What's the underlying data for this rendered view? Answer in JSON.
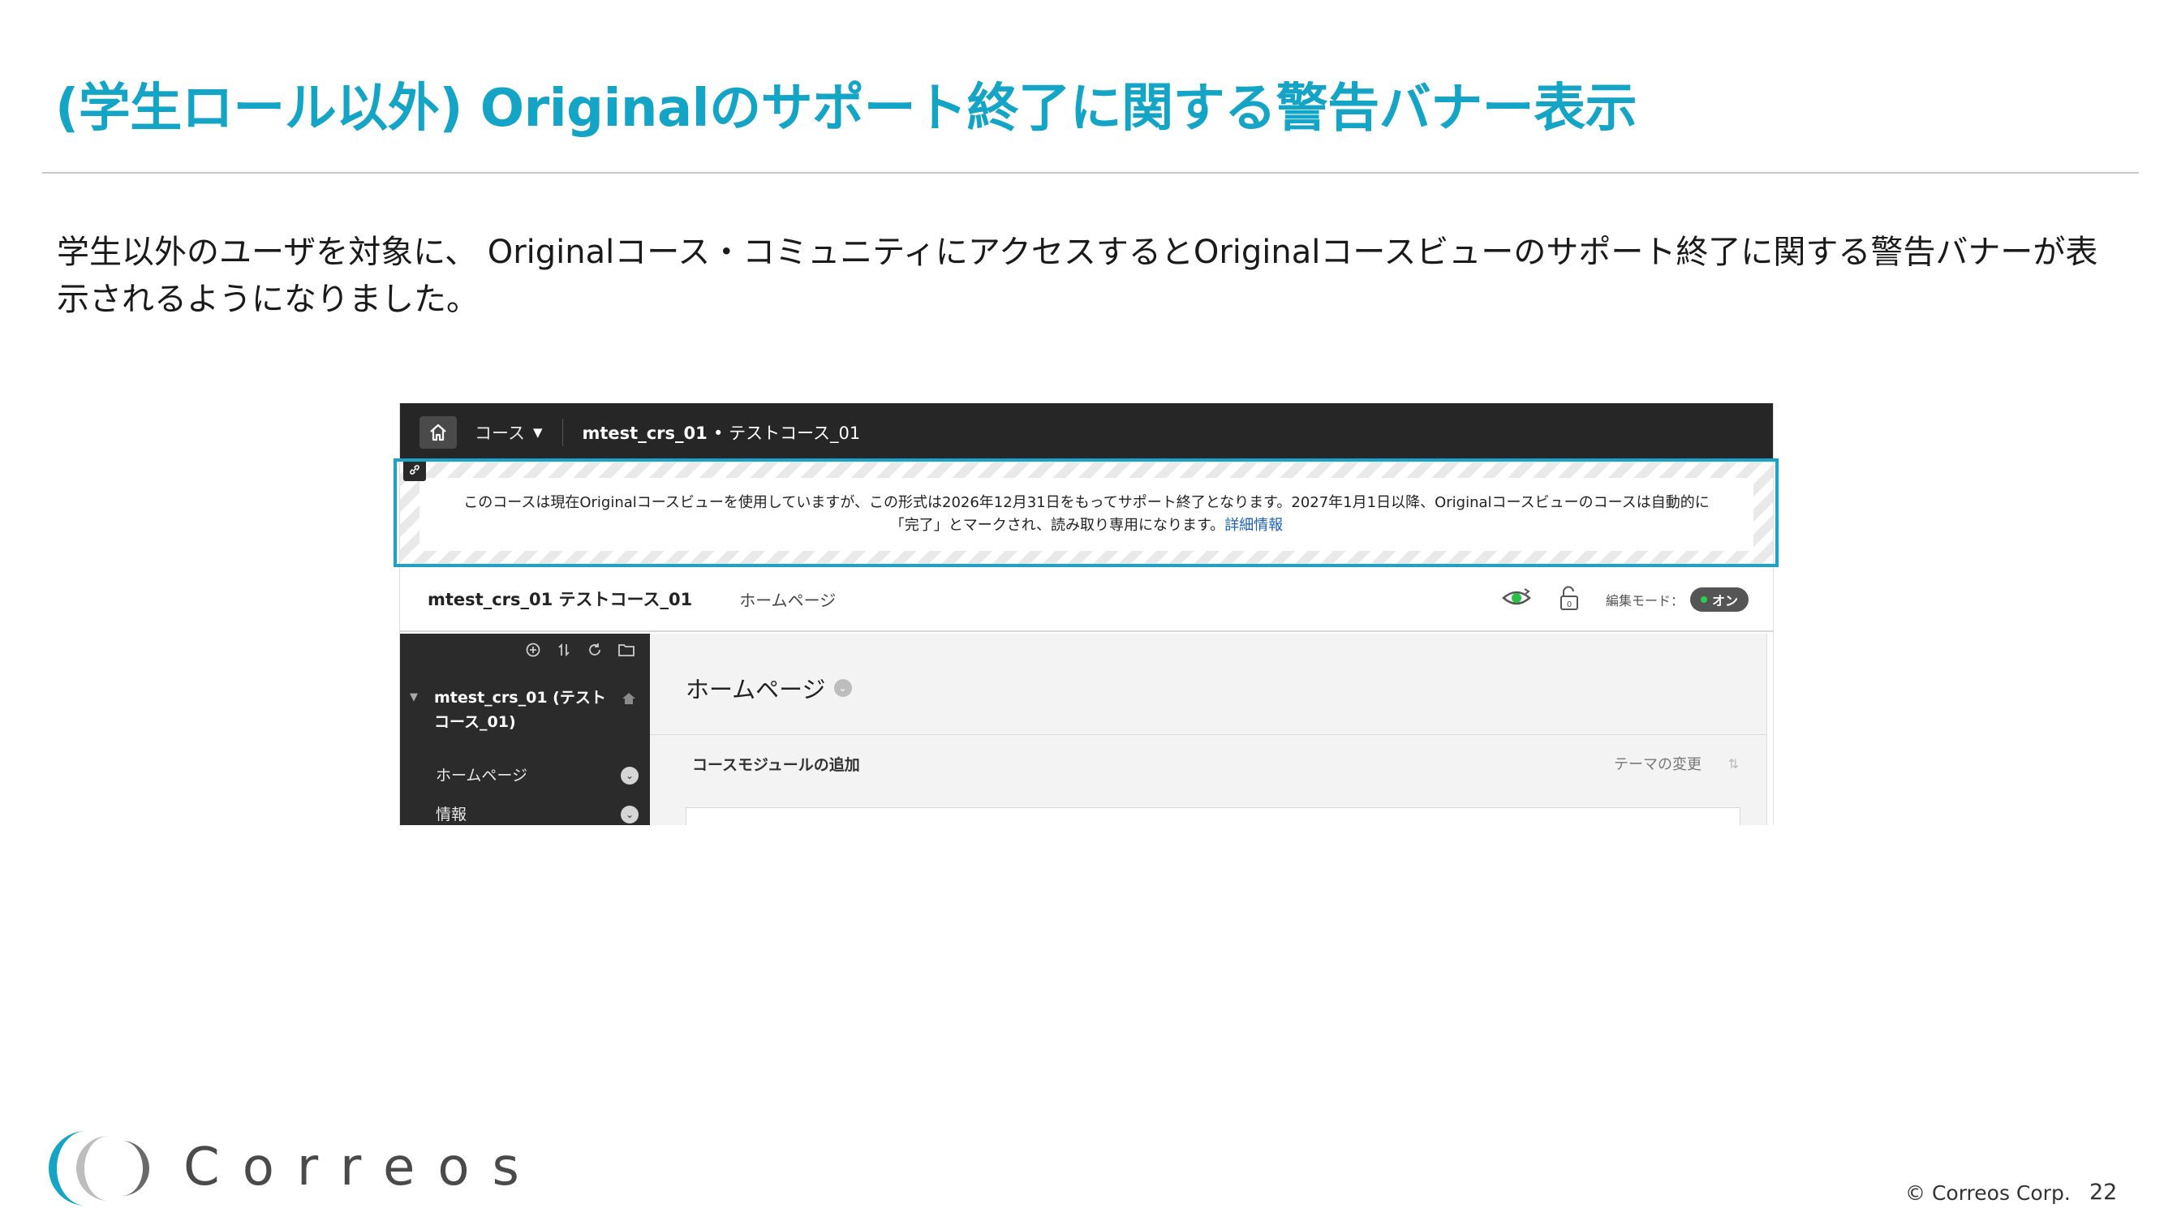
{
  "slide": {
    "title": "(学生ロール以外) Originalのサポート終了に関する警告バナー表示",
    "body": "学生以外のユーザを対象に、 Originalコース・コミュニティにアクセスするとOriginalコースビューのサポート終了に関する警告バナーが表示されるようになりました。"
  },
  "screenshot": {
    "topnav": {
      "course_label": "コース",
      "crumb_bold": "mtest_crs_01",
      "crumb_rest": "• テストコース_01"
    },
    "banner": {
      "line1": "このコースは現在Originalコースビューを使用していますが、この形式は2026年12月31日をもってサポート終了となります。2027年1月1日以降、Originalコースビューのコースは自動的に",
      "line2": "「完了」とマークされ、読み取り専用になります。",
      "link": "詳細情報"
    },
    "course_header": {
      "title": "mtest_crs_01 テストコース_01",
      "page": "ホームページ",
      "edit_mode_label": "編集モード：",
      "edit_mode_value": "オン",
      "lock_count": "0"
    },
    "sidebar": {
      "course_name": "mtest_crs_01 (テストコース_01)",
      "items": [
        {
          "label": "ホームページ"
        },
        {
          "label": "情報"
        }
      ]
    },
    "content": {
      "title": "ホームページ",
      "add_module": "コースモジュールの追加",
      "theme_change": "テーマの変更"
    }
  },
  "footer": {
    "logo_text": "Correos",
    "copyright": "© Correos Corp.",
    "page_number": "22"
  },
  "colors": {
    "accent": "#14a5c6",
    "highlight": "#1aa3c9",
    "nav_bg": "#262626",
    "sidebar_bg": "#2b2b2b",
    "toggle_on": "#27d34a",
    "link": "#1a62b5"
  }
}
